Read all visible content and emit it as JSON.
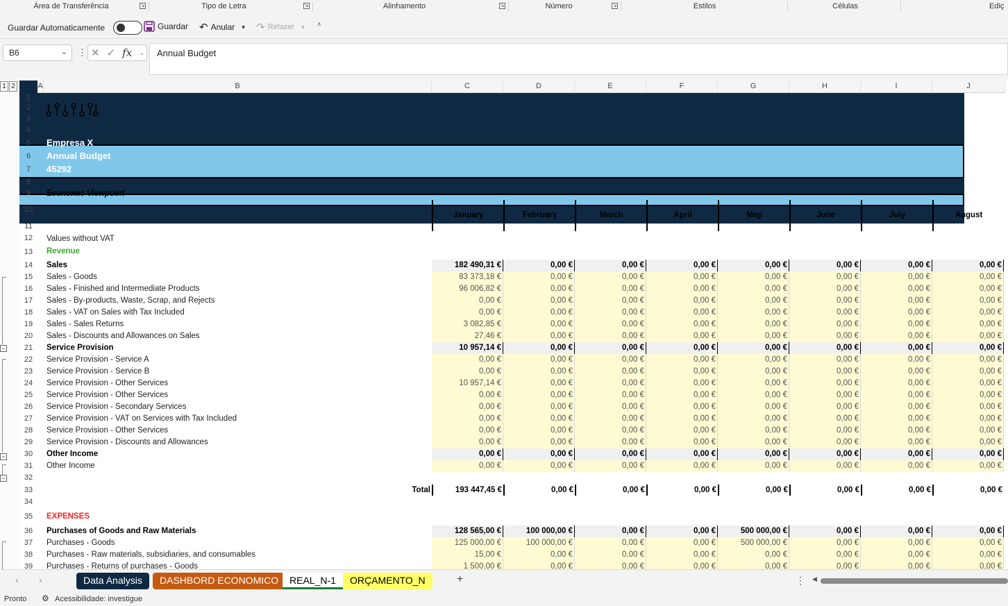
{
  "ribbon": {
    "groups": [
      "Área de Transferência",
      "Tipo de Letra",
      "Alinhamento",
      "Número",
      "Estilos",
      "Células",
      "Ediç"
    ]
  },
  "qat": {
    "autosave_label": "Guardar Automaticamente",
    "save_label": "Guardar",
    "undo_label": "Anular",
    "redo_label": "Refazer"
  },
  "formula_bar": {
    "name_box": "B6",
    "fx": "fx",
    "content": "Annual Budget"
  },
  "outline_levels": [
    "1",
    "2"
  ],
  "columns": [
    "A",
    "B",
    "C",
    "D",
    "E",
    "F",
    "G",
    "H",
    "I",
    "J"
  ],
  "sheet": {
    "company": "Empresa X",
    "title": "Annual Budget",
    "date_serial": "45292",
    "viewpoint": "Economic Viewpoint",
    "values_note": "Values without VAT",
    "months": [
      "January",
      "February",
      "March",
      "April",
      "May",
      "June",
      "July",
      "August"
    ],
    "revenue_label": "Revenue",
    "expenses_label": "EXPENSES",
    "total_label": "Total",
    "rows": [
      {
        "r": "14",
        "label": "Sales",
        "type": "bold",
        "vals": [
          "182 490,31 €",
          "0,00 €",
          "0,00 €",
          "0,00 €",
          "0,00 €",
          "0,00 €",
          "0,00 €",
          "0,00 €"
        ]
      },
      {
        "r": "15",
        "label": "Sales - Goods",
        "type": "y",
        "vals": [
          "83 373,18 €",
          "0,00 €",
          "0,00 €",
          "0,00 €",
          "0,00 €",
          "0,00 €",
          "0,00 €",
          "0,00 €"
        ]
      },
      {
        "r": "16",
        "label": "Sales - Finished and Intermediate Products",
        "type": "y",
        "vals": [
          "96 006,82 €",
          "0,00 €",
          "0,00 €",
          "0,00 €",
          "0,00 €",
          "0,00 €",
          "0,00 €",
          "0,00 €"
        ]
      },
      {
        "r": "17",
        "label": "Sales - By-products, Waste, Scrap, and Rejects",
        "type": "y",
        "vals": [
          "0,00 €",
          "0,00 €",
          "0,00 €",
          "0,00 €",
          "0,00 €",
          "0,00 €",
          "0,00 €",
          "0,00 €"
        ]
      },
      {
        "r": "18",
        "label": "Sales - VAT on Sales with Tax Included",
        "type": "y",
        "vals": [
          "0,00 €",
          "0,00 €",
          "0,00 €",
          "0,00 €",
          "0,00 €",
          "0,00 €",
          "0,00 €",
          "0,00 €"
        ]
      },
      {
        "r": "19",
        "label": "Sales - Sales Returns",
        "type": "y",
        "vals": [
          "3 082,85 €",
          "0,00 €",
          "0,00 €",
          "0,00 €",
          "0,00 €",
          "0,00 €",
          "0,00 €",
          "0,00 €"
        ]
      },
      {
        "r": "20",
        "label": "Sales - Discounts and Allowances on Sales",
        "type": "y",
        "vals": [
          "27,46 €",
          "0,00 €",
          "0,00 €",
          "0,00 €",
          "0,00 €",
          "0,00 €",
          "0,00 €",
          "0,00 €"
        ]
      },
      {
        "r": "21",
        "label": "Service Provision",
        "type": "bold",
        "vals": [
          "10 957,14 €",
          "0,00 €",
          "0,00 €",
          "0,00 €",
          "0,00 €",
          "0,00 €",
          "0,00 €",
          "0,00 €"
        ]
      },
      {
        "r": "22",
        "label": "Service Provision - Service A",
        "type": "y",
        "vals": [
          "0,00 €",
          "0,00 €",
          "0,00 €",
          "0,00 €",
          "0,00 €",
          "0,00 €",
          "0,00 €",
          "0,00 €"
        ]
      },
      {
        "r": "23",
        "label": "Service Provision - Service B",
        "type": "y",
        "vals": [
          "0,00 €",
          "0,00 €",
          "0,00 €",
          "0,00 €",
          "0,00 €",
          "0,00 €",
          "0,00 €",
          "0,00 €"
        ]
      },
      {
        "r": "24",
        "label": "Service Provision - Other Services",
        "type": "y",
        "vals": [
          "10 957,14 €",
          "0,00 €",
          "0,00 €",
          "0,00 €",
          "0,00 €",
          "0,00 €",
          "0,00 €",
          "0,00 €"
        ]
      },
      {
        "r": "25",
        "label": "Service Provision - Other Services",
        "type": "y",
        "vals": [
          "0,00 €",
          "0,00 €",
          "0,00 €",
          "0,00 €",
          "0,00 €",
          "0,00 €",
          "0,00 €",
          "0,00 €"
        ]
      },
      {
        "r": "26",
        "label": "Service Provision - Secondary Services",
        "type": "y",
        "vals": [
          "0,00 €",
          "0,00 €",
          "0,00 €",
          "0,00 €",
          "0,00 €",
          "0,00 €",
          "0,00 €",
          "0,00 €"
        ]
      },
      {
        "r": "27",
        "label": "Service Provision - VAT on Services with Tax Included",
        "type": "y",
        "vals": [
          "0,00 €",
          "0,00 €",
          "0,00 €",
          "0,00 €",
          "0,00 €",
          "0,00 €",
          "0,00 €",
          "0,00 €"
        ]
      },
      {
        "r": "28",
        "label": "Service Provision - Other Services",
        "type": "y",
        "vals": [
          "0,00 €",
          "0,00 €",
          "0,00 €",
          "0,00 €",
          "0,00 €",
          "0,00 €",
          "0,00 €",
          "0,00 €"
        ]
      },
      {
        "r": "29",
        "label": "Service Provision - Discounts and Allowances",
        "type": "y",
        "vals": [
          "0,00 €",
          "0,00 €",
          "0,00 €",
          "0,00 €",
          "0,00 €",
          "0,00 €",
          "0,00 €",
          "0,00 €"
        ]
      },
      {
        "r": "30",
        "label": "Other Income",
        "type": "bold",
        "vals": [
          "0,00 €",
          "0,00 €",
          "0,00 €",
          "0,00 €",
          "0,00 €",
          "0,00 €",
          "0,00 €",
          "0,00 €"
        ]
      },
      {
        "r": "31",
        "label": "Other Income",
        "type": "y",
        "vals": [
          "0,00 €",
          "0,00 €",
          "0,00 €",
          "0,00 €",
          "0,00 €",
          "0,00 €",
          "0,00 €",
          "0,00 €"
        ]
      }
    ],
    "total_vals": [
      "193 447,45 €",
      "0,00 €",
      "0,00 €",
      "0,00 €",
      "0,00 €",
      "0,00 €",
      "0,00 €",
      "0,00 €"
    ],
    "expense_rows": [
      {
        "r": "36",
        "label": "Purchases of Goods and Raw Materials",
        "type": "bold",
        "vals": [
          "128 565,00 €",
          "100 000,00 €",
          "0,00 €",
          "0,00 €",
          "500 000,00 €",
          "0,00 €",
          "0,00 €",
          "0,00 €"
        ]
      },
      {
        "r": "37",
        "label": "Purchases - Goods",
        "type": "y",
        "vals": [
          "125 000,00 €",
          "100 000,00 €",
          "0,00 €",
          "0,00 €",
          "500 000,00 €",
          "0,00 €",
          "0,00 €",
          "0,00 €"
        ]
      },
      {
        "r": "38",
        "label": "Purchases - Raw materials, subsidiaries, and consumables",
        "type": "y",
        "vals": [
          "15,00 €",
          "0,00 €",
          "0,00 €",
          "0,00 €",
          "0,00 €",
          "0,00 €",
          "0,00 €",
          "0,00 €"
        ]
      },
      {
        "r": "39",
        "label": "Purchases - Returns of purchases - Goods",
        "type": "y",
        "vals": [
          "1 500,00 €",
          "0,00 €",
          "0,00 €",
          "0,00 €",
          "0,00 €",
          "0,00 €",
          "0,00 €",
          "0,00 €"
        ]
      }
    ]
  },
  "tabs": [
    {
      "label": "Data Analysis",
      "bg": "#0f2942",
      "fg": "#ffffff"
    },
    {
      "label": "DASHBORD ECONOMICO",
      "bg": "#c55a11",
      "fg": "#ffffff"
    },
    {
      "label": "REAL_N-1",
      "bg": "#ffffff",
      "fg": "#000000"
    },
    {
      "label": "ORÇAMENTO_N",
      "bg": "#ffff66",
      "fg": "#000000"
    }
  ],
  "status": {
    "ready": "Pronto",
    "accessibility": "Acessibilidade: investigue"
  }
}
